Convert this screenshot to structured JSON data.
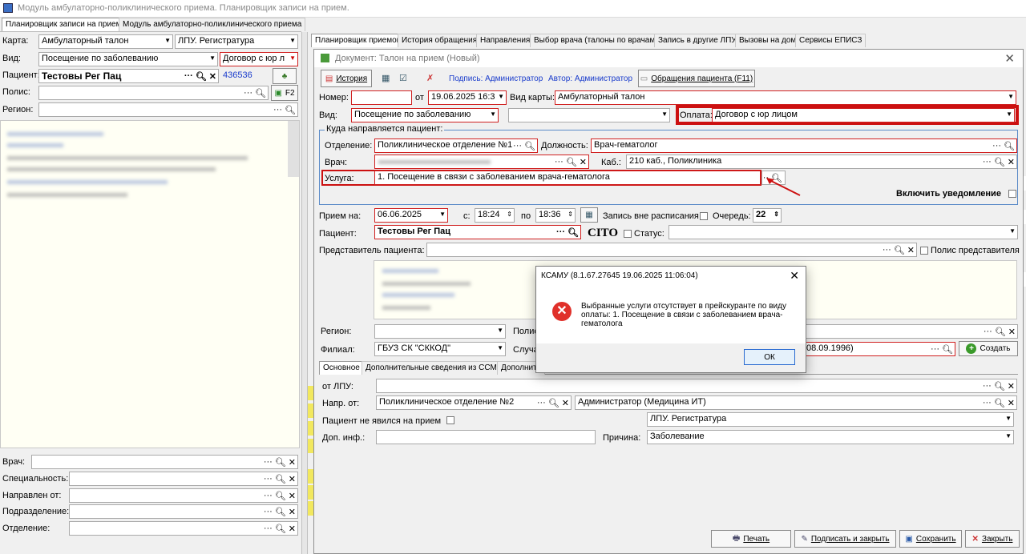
{
  "window": {
    "title": "Модуль амбулаторно-поликлинического приема. Планировщик записи на прием."
  },
  "main_tabs": [
    "Планировщик записи на прием",
    "Модуль амбулаторно-поликлинического приема"
  ],
  "left": {
    "karta_label": "Карта:",
    "karta_value": "Амбулаторный талон",
    "karta_lpu": "ЛПУ. Регистратура",
    "vid_label": "Вид:",
    "vid_value": "Посещение по заболеванию",
    "vid_contract": "Договор с юр л",
    "patient_label": "Пациент:",
    "patient_value": "Тестовы Рег Пац",
    "patient_id": "436536",
    "polis_label": "Полис:",
    "f2": "F2",
    "region_label": "Регион:",
    "vrach_label": "Врач:",
    "spec_label": "Специальность:",
    "napr_label": "Направлен от:",
    "podr_label": "Подразделение:",
    "otd_label": "Отделение:"
  },
  "top_tabs": [
    "Планировщик приемов",
    "История обращения",
    "Направления",
    "Выбор врача (талоны по врачам)",
    "Запись в другие ЛПУ",
    "Вызовы на дом",
    "Сервисы ЕПИСЗ"
  ],
  "doc": {
    "title": "Документ: Талон на прием (Новый)",
    "toolbar": {
      "history": "История",
      "signature": "Подпись: Администратор",
      "author": "Автор: Администратор",
      "visits": "Обращения пациента (F11)"
    },
    "nomer_label": "Номер:",
    "ot_label": "от",
    "ot_value": "19.06.2025 16:3",
    "vid_karty_label": "Вид карты:",
    "vid_karty_value": "Амбулаторный талон",
    "vid_label": "Вид:",
    "vid_value": "Посещение по заболеванию",
    "oplata_label": "Оплата:",
    "oplata_value": "Договор с юр лицом",
    "group_title": "Куда направляется пациент:",
    "otd_label": "Отделение:",
    "otd_value": "Поликлиническое отделение №1",
    "dolzh_label": "Должность:",
    "dolzh_value": "Врач-гематолог",
    "vrach_label": "Врач:",
    "kab_label": "Каб.:",
    "kab_value": "210 каб., Поликлиника",
    "usluga_label": "Услуга:",
    "usluga_value": "1. Посещение в связи с заболеванием врача-гематолога",
    "notify": "Включить уведомление",
    "priem_label": "Прием на:",
    "priem_date": "06.06.2025",
    "s_label": "с:",
    "s_time": "18:24",
    "po_label": "по",
    "po_time": "18:36",
    "vne_label": "Запись вне расписания",
    "ochered_label": "Очередь:",
    "ochered_value": "22",
    "patient_label": "Пациент:",
    "patient_value": "Тестовы Рег Пац",
    "cito": "CITO",
    "status_label": "Статус:",
    "rep_label": "Представитель пациента:",
    "rep_polis": "Полис представителя",
    "region_label": "Регион:",
    "polis_label": "Полис",
    "filial_label": "Филиал:",
    "filial_value": "ГБУЗ СК \"СККОД\"",
    "sluch_label": "Случа",
    "birth_fragment": "08.09.1996)",
    "create_label": "Создать",
    "sub_tabs": [
      "Основное",
      "Дополнительные сведения из ССМП",
      "Дополните"
    ],
    "ot_lpu_label": "от ЛПУ:",
    "napr_ot_label": "Напр. от:",
    "napr_ot_value": "Поликлиническое отделение №2",
    "napr_ot_admin": "Администратор (Медицина ИТ)",
    "ne_yavilsya": "Пациент не явился на прием",
    "lpu_reg": "ЛПУ. Регистратура",
    "dop_label": "Доп. инф.:",
    "prichina_label": "Причина:",
    "prichina_value": "Заболевание",
    "buttons": {
      "print": "Печать",
      "sign_close": "Подписать и закрыть",
      "save": "Сохранить",
      "close": "Закрыть"
    }
  },
  "dialog": {
    "title": "КСАМУ (8.1.67.27645 19.06.2025 11:06:04)",
    "message": "Выбранные услуги отсутствует в прейскуранте по виду оплаты: 1. Посещение в связи с заболеванием врача-гематолога",
    "ok": "ОК"
  },
  "colors": {
    "highlight_red": "#cc1010",
    "link_blue": "#1a3ccc",
    "accent_yellow": "#f2e85e"
  }
}
